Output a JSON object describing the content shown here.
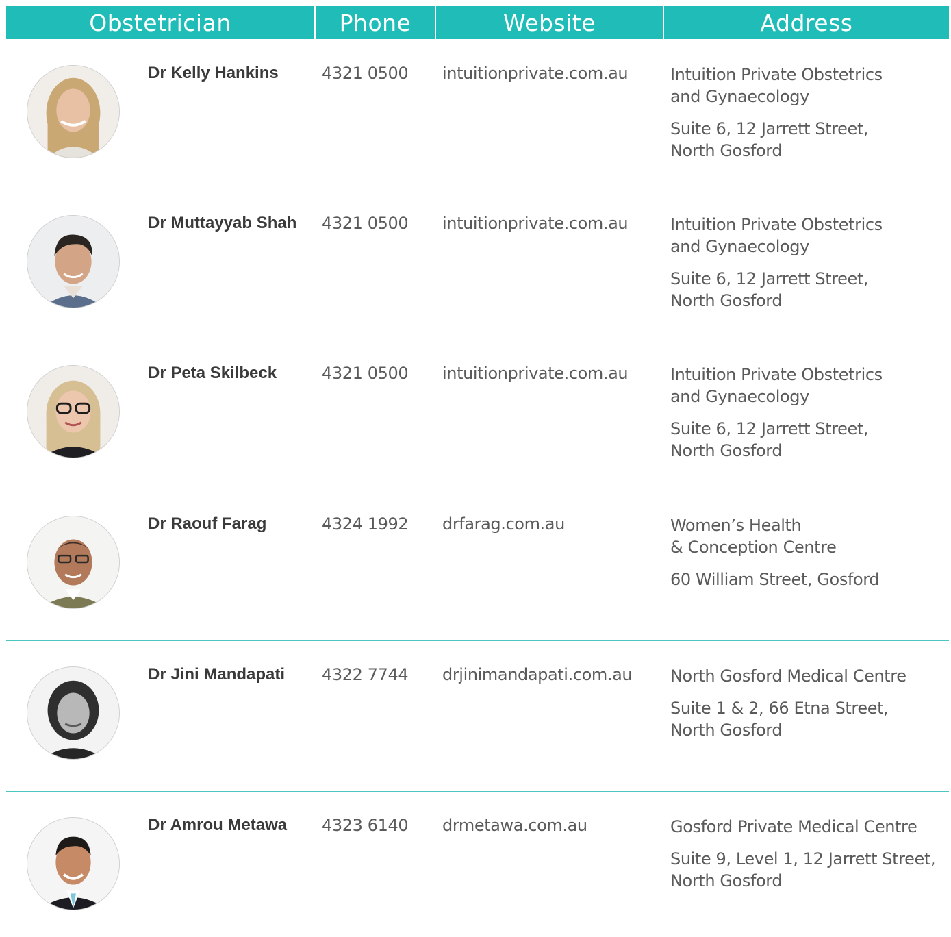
{
  "header": {
    "obstetrician": "Obstetrician",
    "phone": "Phone",
    "website": "Website",
    "address": "Address"
  },
  "colors": {
    "accent": "#20bdb8",
    "divider": "#4cc6c0"
  },
  "doctors": [
    {
      "name": "Dr Kelly Hankins",
      "phone": "4321 0500",
      "website": "intuitionprivate.com.au",
      "address_name": "Intuition Private Obstetrics\nand Gynaecology",
      "address_street": "Suite 6, 12 Jarrett Street,\nNorth Gosford",
      "photo": "woman-blonde-avatar"
    },
    {
      "name": "Dr Muttayyab Shah",
      "phone": "4321 0500",
      "website": "intuitionprivate.com.au",
      "address_name": "Intuition Private Obstetrics\nand Gynaecology",
      "address_street": "Suite 6, 12 Jarrett Street,\nNorth Gosford",
      "photo": "man-dark-hair-avatar"
    },
    {
      "name": "Dr Peta Skilbeck",
      "phone": "4321 0500",
      "website": "intuitionprivate.com.au",
      "address_name": "Intuition Private Obstetrics\nand Gynaecology",
      "address_street": "Suite 6, 12 Jarrett Street,\nNorth Gosford",
      "photo": "woman-glasses-avatar"
    },
    {
      "name": "Dr Raouf Farag",
      "phone": "4324 1992",
      "website": "drfarag.com.au",
      "address_name": "Women’s Health\n& Conception Centre",
      "address_street": "60 William Street, Gosford",
      "photo": "man-glasses-avatar"
    },
    {
      "name": "Dr Jini Mandapati",
      "phone": "4322 7744",
      "website": "drjinimandapati.com.au",
      "address_name": "North Gosford Medical Centre",
      "address_street": "Suite 1 & 2, 66 Etna Street,\nNorth Gosford",
      "photo": "woman-grayscale-avatar"
    },
    {
      "name": "Dr Amrou Metawa",
      "phone": "4323 6140",
      "website": "drmetawa.com.au",
      "address_name": "Gosford Private Medical Centre",
      "address_street": "Suite 9, Level 1, 12 Jarrett Street,\nNorth Gosford",
      "photo": "man-suit-avatar"
    }
  ]
}
